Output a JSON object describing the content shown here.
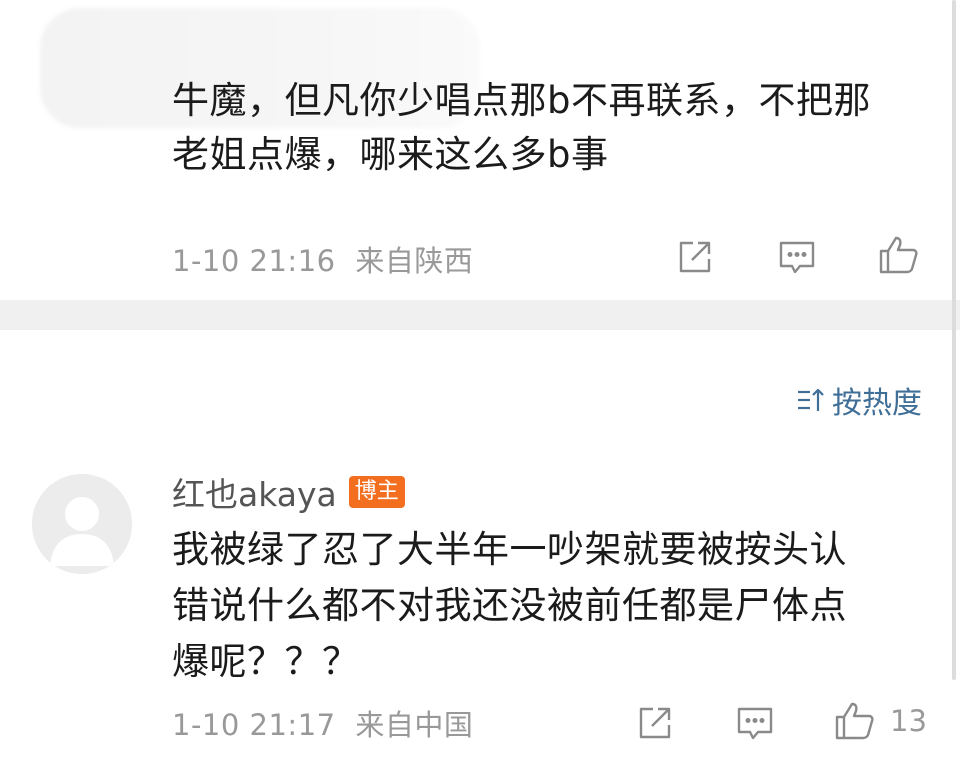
{
  "comment1": {
    "line1": "牛魔，但凡你少唱点那b不再联系，不把那",
    "line2": "老姐点爆，哪来这么多b事",
    "timestamp": "1-10 21:16",
    "location": "来自陕西"
  },
  "sort": {
    "label": "按热度"
  },
  "comment2": {
    "username": "红也akaya",
    "badge": "博主",
    "line1": "我被绿了忍了大半年一吵架就要被按头认",
    "line2": "错说什么都不对我还没被前任都是尸体点",
    "line3": "爆呢？？？",
    "timestamp": "1-10 21:17",
    "location": "来自中国",
    "like_count": "13"
  },
  "colors": {
    "text": "#1b1b1b",
    "meta": "#999999",
    "link": "#3f6f97",
    "badge": "#f36e1f",
    "separator": "#f0f0f0"
  },
  "icons": [
    "share-icon",
    "comment-icon",
    "like-icon",
    "sort-icon",
    "avatar-placeholder-icon"
  ]
}
